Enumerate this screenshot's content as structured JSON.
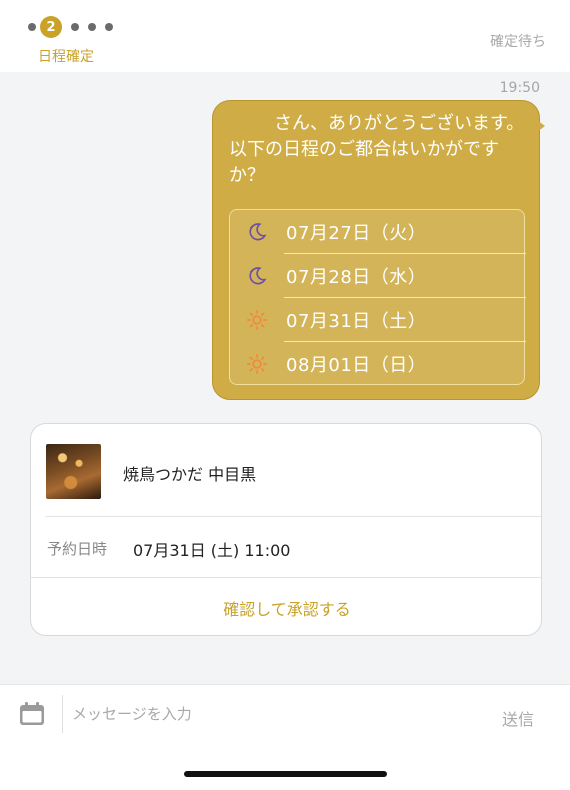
{
  "header": {
    "current_step": "2",
    "step_label": "日程確定",
    "status": "確定待ち"
  },
  "chat": {
    "timestamp": "19:50",
    "message": "さん、ありがとうございます。以下の日程のご都合はいかがですか？",
    "date_options": [
      {
        "label": "07月27日（火）",
        "icon": "moon-icon"
      },
      {
        "label": "07月28日（水）",
        "icon": "moon-icon"
      },
      {
        "label": "07月31日（土）",
        "icon": "sun-icon"
      },
      {
        "label": "08月01日（日）",
        "icon": "sun-icon"
      }
    ]
  },
  "reservation": {
    "shop_name": "焼鳥つかだ 中目黒",
    "datetime_label": "予約日時",
    "datetime_value": "07月31日 (土) 11:00",
    "confirm_label": "確認して承認する"
  },
  "composer": {
    "placeholder": "メッセージを入力",
    "send_label": "送信"
  },
  "colors": {
    "accent": "#c9a227",
    "bubble": "#cfac46",
    "moon": "#6d4fa8",
    "sun": "#f08a3c"
  }
}
